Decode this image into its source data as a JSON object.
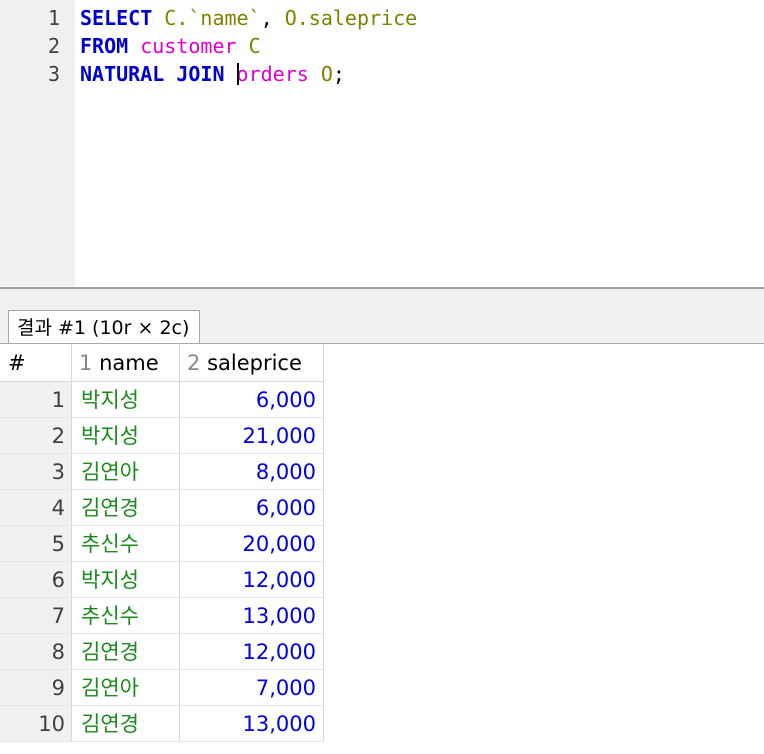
{
  "editor": {
    "line_numbers": [
      "1",
      "2",
      "3"
    ],
    "line1": {
      "kw": "SELECT",
      "col1": "C.`name`",
      "sep": ",",
      "col2": "O.saleprice"
    },
    "line2": {
      "kw": "FROM",
      "table": "customer",
      "alias": "C"
    },
    "line3": {
      "kw": "NATURAL JOIN",
      "table": "orders",
      "alias": "O",
      "end": ";"
    }
  },
  "results": {
    "tab_label": "결과 #1 (10r × 2c)",
    "header": {
      "row_index": "#",
      "columns": [
        {
          "index": "1",
          "name": "name"
        },
        {
          "index": "2",
          "name": "saleprice"
        }
      ]
    },
    "rows": [
      {
        "n": "1",
        "name": "박지성",
        "saleprice": "6,000"
      },
      {
        "n": "2",
        "name": "박지성",
        "saleprice": "21,000"
      },
      {
        "n": "3",
        "name": "김연아",
        "saleprice": "8,000"
      },
      {
        "n": "4",
        "name": "김연경",
        "saleprice": "6,000"
      },
      {
        "n": "5",
        "name": "추신수",
        "saleprice": "20,000"
      },
      {
        "n": "6",
        "name": "박지성",
        "saleprice": "12,000"
      },
      {
        "n": "7",
        "name": "추신수",
        "saleprice": "13,000"
      },
      {
        "n": "8",
        "name": "김연경",
        "saleprice": "12,000"
      },
      {
        "n": "9",
        "name": "김연아",
        "saleprice": "7,000"
      },
      {
        "n": "10",
        "name": "김연경",
        "saleprice": "13,000"
      }
    ]
  },
  "colors": {
    "keyword": "#0000d0",
    "identifier": "#808000",
    "table": "#e000d0",
    "text_value": "#1a8a1a",
    "numeric_value": "#0000e0"
  }
}
